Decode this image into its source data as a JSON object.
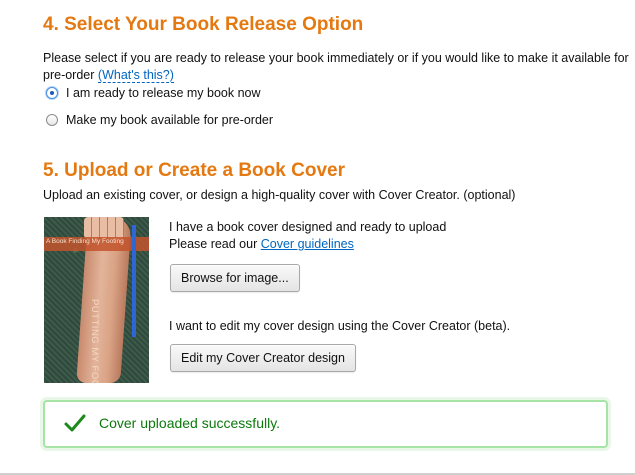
{
  "release_section": {
    "title": "4. Select Your Book Release Option",
    "description_line1": "Please select if you are ready to release your book immediately or if you would like to make it available for",
    "description_line2_prefix": "pre-order",
    "whats_this_link": "(What's this?)",
    "options": [
      {
        "label": "I am ready to release my book now",
        "selected": true
      },
      {
        "label": "Make my book available for pre-order",
        "selected": false
      }
    ]
  },
  "cover_section": {
    "title": "5. Upload or Create a Book Cover",
    "description": "Upload an existing cover, or design a high-quality cover with Cover Creator. (optional)",
    "cover_thumbnail": {
      "strip_text": "A Book Finding My Footing",
      "vertical_text": "PUTTING MY FOOT DOWN"
    },
    "upload_text": "I have a book cover designed and ready to upload",
    "guidelines_prefix": "Please read our",
    "guidelines_link": "Cover guidelines",
    "browse_button": "Browse for image...",
    "creator_text": "I want to edit my cover design using the Cover Creator (beta).",
    "creator_button": "Edit my Cover Creator design"
  },
  "alert": {
    "message": "Cover uploaded successfully.",
    "icon": "checkmark-icon",
    "color": "#0b7a0b"
  },
  "colors": {
    "heading": "#e47911",
    "link": "#0066c0",
    "success_border": "#a6e3a6"
  }
}
